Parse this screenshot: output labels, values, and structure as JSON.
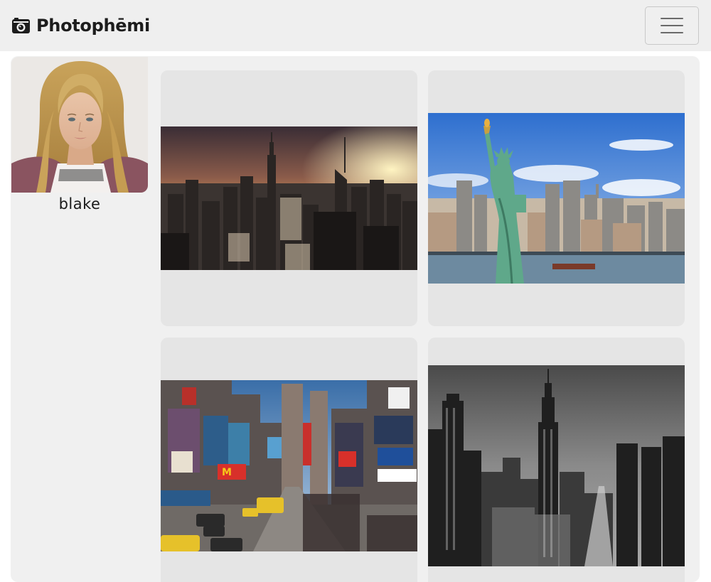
{
  "header": {
    "brand_name": "Photophēmi",
    "logo_icon": "camera-icon",
    "menu_icon": "hamburger-menu-icon"
  },
  "profile": {
    "username": "blake",
    "avatar_icon": "profile-avatar"
  },
  "photos": [
    {
      "subject": "new-york-skyline-sunset"
    },
    {
      "subject": "statue-of-liberty-skyline"
    },
    {
      "subject": "times-square"
    },
    {
      "subject": "empire-state-black-and-white"
    }
  ],
  "colors": {
    "header_bg": "#efefef",
    "content_bg": "#f0f0f0",
    "card_bg": "#e5e5e5",
    "text": "#1d1d1d"
  }
}
